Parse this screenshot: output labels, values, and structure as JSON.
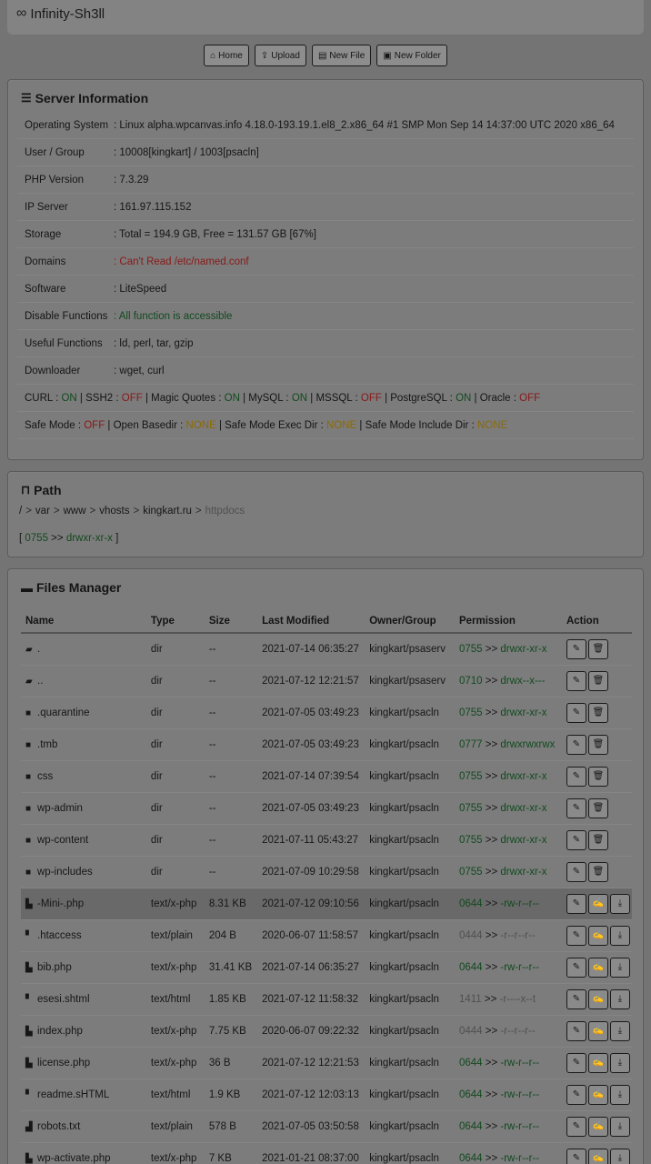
{
  "brand": {
    "logo_icon": "infinity-icon",
    "title": "Infinity-Sh3ll"
  },
  "toolbar": {
    "home": "Home",
    "upload": "Upload",
    "new_file": "New File",
    "new_folder": "New Folder"
  },
  "server_info": {
    "title": "Server Information",
    "rows": [
      {
        "label": "Operating System",
        "value": ": Linux alpha.wpcanvas.info 4.18.0-193.19.1.el8_2.x86_64 #1 SMP Mon Sep 14 14:37:00 UTC 2020 x86_64"
      },
      {
        "label": "User / Group",
        "value": ": 10008[kingkart] / 1003[psacln]"
      },
      {
        "label": "PHP Version",
        "value": ": 7.3.29"
      },
      {
        "label": "IP Server",
        "value": ": 161.97.115.152"
      },
      {
        "label": "Storage",
        "value": ": Total = 194.9 GB, Free = 131.57 GB [67%]"
      },
      {
        "label": "Domains",
        "value": ": Can't Read /etc/named.conf"
      },
      {
        "label": "Software",
        "value": ": LiteSpeed"
      },
      {
        "label": "Disable Functions",
        "value": ": All function is accessible"
      },
      {
        "label": "Useful Functions",
        "value": ": ld, perl, tar, gzip"
      },
      {
        "label": "Downloader",
        "value": ": wget, curl"
      }
    ],
    "ext": {
      "curl_l": "CURL : ",
      "curl_v": "ON",
      "ssh2_l": " | SSH2 : ",
      "ssh2_v": "OFF",
      "mq_l": " | Magic Quotes : ",
      "mq_v": "ON",
      "mysql_l": " | MySQL : ",
      "mysql_v": "ON",
      "mssql_l": " | MSSQL : ",
      "mssql_v": "OFF",
      "pg_l": " | PostgreSQL : ",
      "pg_v": "ON",
      "ora_l": " | Oracle : ",
      "ora_v": "OFF"
    },
    "safe": {
      "sm_l": "Safe Mode : ",
      "sm_v": "OFF",
      "ob_l": " | Open Basedir : ",
      "ob_v": "NONE",
      "sme_l": " | Safe Mode Exec Dir : ",
      "sme_v": "NONE",
      "smi_l": " | Safe Mode Include Dir : ",
      "smi_v": "NONE"
    }
  },
  "path": {
    "title": "Path",
    "crumbs": [
      "/",
      ">",
      "var",
      ">",
      "www",
      ">",
      "vhosts",
      ">",
      "kingkart.ru",
      ">",
      "httpdocs"
    ],
    "perm_open": "[ ",
    "perm_code": "0755",
    "perm_arrow": " >> ",
    "perm_str": "drwxr-xr-x",
    "perm_close": " ]"
  },
  "files": {
    "title": "Files Manager",
    "headers": [
      "Name",
      "Type",
      "Size",
      "Last Modified",
      "Owner/Group",
      "Permission",
      "Action"
    ],
    "rows": [
      {
        "icon": "folder-open-icon",
        "name": ".",
        "type": "dir",
        "size": "--",
        "modified": "2021-07-14 06:35:27",
        "owner": "kingkart/psaserv",
        "perm_code": "0755",
        "perm_str": "drwxr-xr-x",
        "perm_color": "green"
      },
      {
        "icon": "folder-open-icon",
        "name": "..",
        "type": "dir",
        "size": "--",
        "modified": "2021-07-12 12:21:57",
        "owner": "kingkart/psaserv",
        "perm_code": "0710",
        "perm_str": "drwx--x---",
        "perm_color": "green"
      },
      {
        "icon": "folder-icon",
        "name": ".quarantine",
        "type": "dir",
        "size": "--",
        "modified": "2021-07-05 03:49:23",
        "owner": "kingkart/psacln",
        "perm_code": "0755",
        "perm_str": "drwxr-xr-x",
        "perm_color": "green"
      },
      {
        "icon": "folder-icon",
        "name": ".tmb",
        "type": "dir",
        "size": "--",
        "modified": "2021-07-05 03:49:23",
        "owner": "kingkart/psacln",
        "perm_code": "0777",
        "perm_str": "drwxrwxrwx",
        "perm_color": "green"
      },
      {
        "icon": "folder-icon",
        "name": "css",
        "type": "dir",
        "size": "--",
        "modified": "2021-07-14 07:39:54",
        "owner": "kingkart/psacln",
        "perm_code": "0755",
        "perm_str": "drwxr-xr-x",
        "perm_color": "green"
      },
      {
        "icon": "folder-icon",
        "name": "wp-admin",
        "type": "dir",
        "size": "--",
        "modified": "2021-07-05 03:49:23",
        "owner": "kingkart/psacln",
        "perm_code": "0755",
        "perm_str": "drwxr-xr-x",
        "perm_color": "green"
      },
      {
        "icon": "folder-icon",
        "name": "wp-content",
        "type": "dir",
        "size": "--",
        "modified": "2021-07-11 05:43:27",
        "owner": "kingkart/psacln",
        "perm_code": "0755",
        "perm_str": "drwxr-xr-x",
        "perm_color": "green"
      },
      {
        "icon": "folder-icon",
        "name": "wp-includes",
        "type": "dir",
        "size": "--",
        "modified": "2021-07-09 10:29:58",
        "owner": "kingkart/psacln",
        "perm_code": "0755",
        "perm_str": "drwxr-xr-x",
        "perm_color": "green"
      },
      {
        "icon": "php-file-icon",
        "name": "-Mini-.php",
        "type": "text/x-php",
        "size": "8.31 KB",
        "modified": "2021-07-12 09:10:56",
        "owner": "kingkart/psacln",
        "perm_code": "0644",
        "perm_str": "-rw-r--r--",
        "perm_color": "green",
        "highlight": true
      },
      {
        "icon": "file-icon",
        "name": ".htaccess",
        "type": "text/plain",
        "size": "204 B",
        "modified": "2020-06-07 11:58:57",
        "owner": "kingkart/psacln",
        "perm_code": "0444",
        "perm_str": "-r--r--r--",
        "perm_color": "muted"
      },
      {
        "icon": "php-file-icon",
        "name": "bib.php",
        "type": "text/x-php",
        "size": "31.41 KB",
        "modified": "2021-07-14 06:35:27",
        "owner": "kingkart/psacln",
        "perm_code": "0644",
        "perm_str": "-rw-r--r--",
        "perm_color": "green"
      },
      {
        "icon": "file-icon",
        "name": "esesi.shtml",
        "type": "text/html",
        "size": "1.85 KB",
        "modified": "2021-07-12 11:58:32",
        "owner": "kingkart/psacln",
        "perm_code": "1411",
        "perm_str": "-r----x--t",
        "perm_color": "muted"
      },
      {
        "icon": "php-file-icon",
        "name": "index.php",
        "type": "text/x-php",
        "size": "7.75 KB",
        "modified": "2020-06-07 09:22:32",
        "owner": "kingkart/psacln",
        "perm_code": "0444",
        "perm_str": "-r--r--r--",
        "perm_color": "muted"
      },
      {
        "icon": "php-file-icon",
        "name": "license.php",
        "type": "text/x-php",
        "size": "36 B",
        "modified": "2021-07-12 12:21:53",
        "owner": "kingkart/psacln",
        "perm_code": "0644",
        "perm_str": "-rw-r--r--",
        "perm_color": "green"
      },
      {
        "icon": "file-icon",
        "name": "readme.sHTML",
        "type": "text/html",
        "size": "1.9 KB",
        "modified": "2021-07-12 12:03:13",
        "owner": "kingkart/psacln",
        "perm_code": "0644",
        "perm_str": "-rw-r--r--",
        "perm_color": "green"
      },
      {
        "icon": "text-file-icon",
        "name": "robots.txt",
        "type": "text/plain",
        "size": "578 B",
        "modified": "2021-07-05 03:50:58",
        "owner": "kingkart/psacln",
        "perm_code": "0644",
        "perm_str": "-rw-r--r--",
        "perm_color": "green"
      },
      {
        "icon": "php-file-icon",
        "name": "wp-activate.php",
        "type": "text/x-php",
        "size": "7 KB",
        "modified": "2021-01-21 08:37:00",
        "owner": "kingkart/psacln",
        "perm_code": "0644",
        "perm_str": "-rw-r--r--",
        "perm_color": "green"
      }
    ]
  },
  "colors": {
    "green": "#124a1f",
    "red": "#8a1818",
    "amber": "#8a6a0a"
  }
}
